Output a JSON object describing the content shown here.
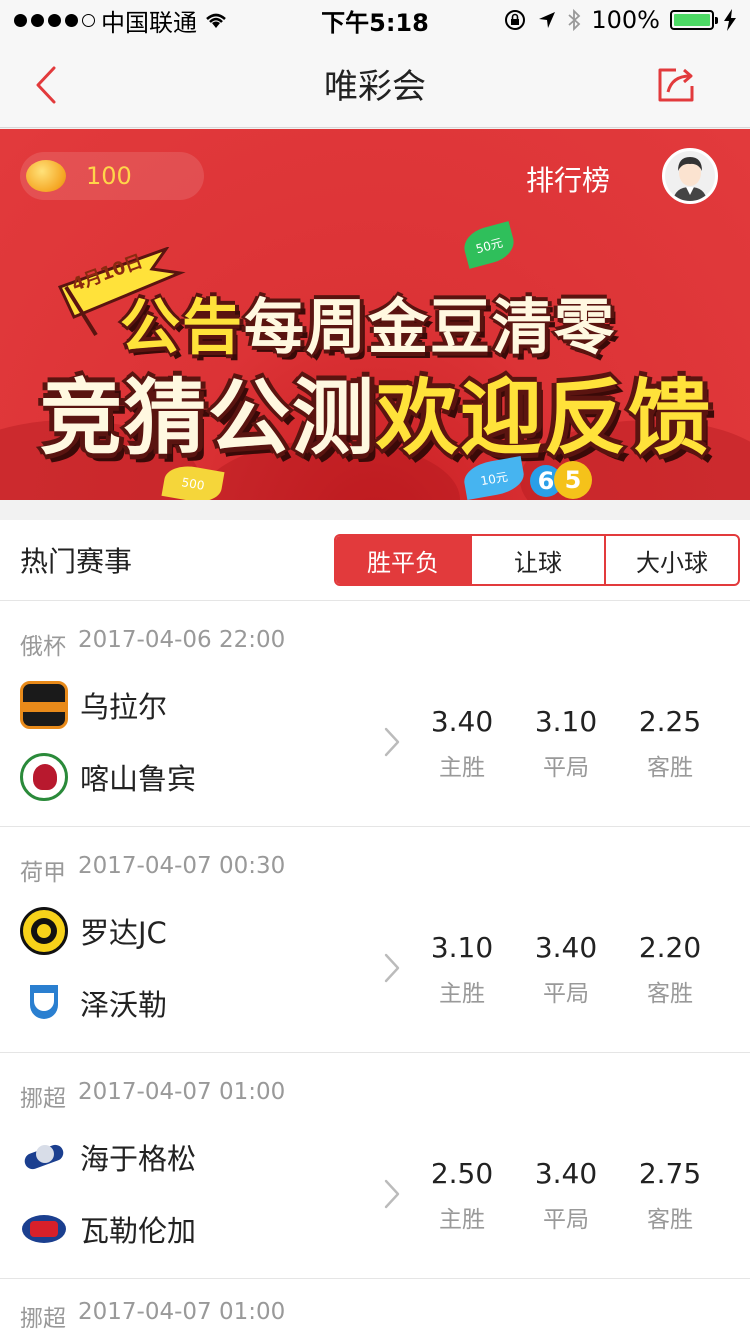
{
  "status_bar": {
    "carrier": "中国联通",
    "time": "下午5:18",
    "battery": "100%",
    "signal_bars_filled": 4,
    "signal_bars_total": 5
  },
  "nav": {
    "title": "唯彩会",
    "back_icon": "back-chevron-icon",
    "share_icon": "share-icon"
  },
  "banner": {
    "coin_value": "100",
    "rank_label": "排行榜",
    "flag_text": "4月10日",
    "headline1_a": "公告",
    "headline1_b": "每周金豆清零",
    "headline2_a": "竞猜公测",
    "headline2_b": "欢迎反馈",
    "leaf_50": "50元",
    "leaf_500": "500",
    "leaf_10": "10元",
    "ball_6": "6",
    "ball_5": "5"
  },
  "hot": {
    "title": "热门赛事",
    "tabs": [
      {
        "label": "胜平负",
        "active": true
      },
      {
        "label": "让球",
        "active": false
      },
      {
        "label": "大小球",
        "active": false
      }
    ]
  },
  "odds_labels": {
    "home": "主胜",
    "draw": "平局",
    "away": "客胜"
  },
  "matches": [
    {
      "league": "俄杯",
      "datetime": "2017-04-06 22:00",
      "home": "乌拉尔",
      "away": "喀山鲁宾",
      "odds": [
        "3.40",
        "3.10",
        "2.25"
      ]
    },
    {
      "league": "荷甲",
      "datetime": "2017-04-07 00:30",
      "home": "罗达JC",
      "away": "泽沃勒",
      "odds": [
        "3.10",
        "3.40",
        "2.20"
      ]
    },
    {
      "league": "挪超",
      "datetime": "2017-04-07 01:00",
      "home": "海于格松",
      "away": "瓦勒伦加",
      "odds": [
        "2.50",
        "3.40",
        "2.75"
      ]
    },
    {
      "league": "挪超",
      "datetime": "2017-04-07 01:00"
    }
  ],
  "colors": {
    "accent": "#e23a3c",
    "banner_red": "#dc3336",
    "gold": "#ffe23a",
    "muted": "#999999"
  }
}
